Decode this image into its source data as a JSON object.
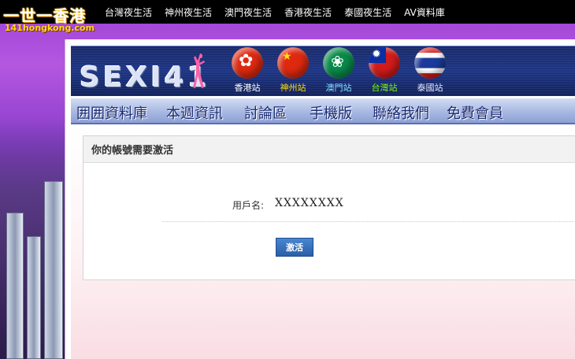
{
  "site": {
    "logo_cn": "一世一香港",
    "logo_en": "141hongkong.com",
    "brand": "SEXI41",
    "top_nav": [
      "台灣夜生活",
      "神州夜生活",
      "澳門夜生活",
      "香港夜生活",
      "泰國夜生活",
      "AV資料庫"
    ]
  },
  "stations": [
    {
      "label": "香港站",
      "color": "#ffffff"
    },
    {
      "label": "神州站",
      "color": "#ffde00"
    },
    {
      "label": "澳門站",
      "color": "#7fe3ff"
    },
    {
      "label": "台灣站",
      "color": "#7cfc00"
    },
    {
      "label": "泰國站",
      "color": "#e6e6ff"
    }
  ],
  "menu": [
    "囲囲資料庫",
    "本週資訊",
    "討論區",
    "手機版",
    "聯絡我們",
    "免費會員"
  ],
  "activation": {
    "title": "你的帳號需要激活",
    "username_label": "用戶名:",
    "username_value": "XXXXXXXX",
    "button_label": "激活"
  },
  "colors": {
    "accent_blue": "#2a5ea8",
    "banner_navy": "#1d3585",
    "menu_text": "#1a2a72",
    "background_purple": "#9b3fd6"
  }
}
